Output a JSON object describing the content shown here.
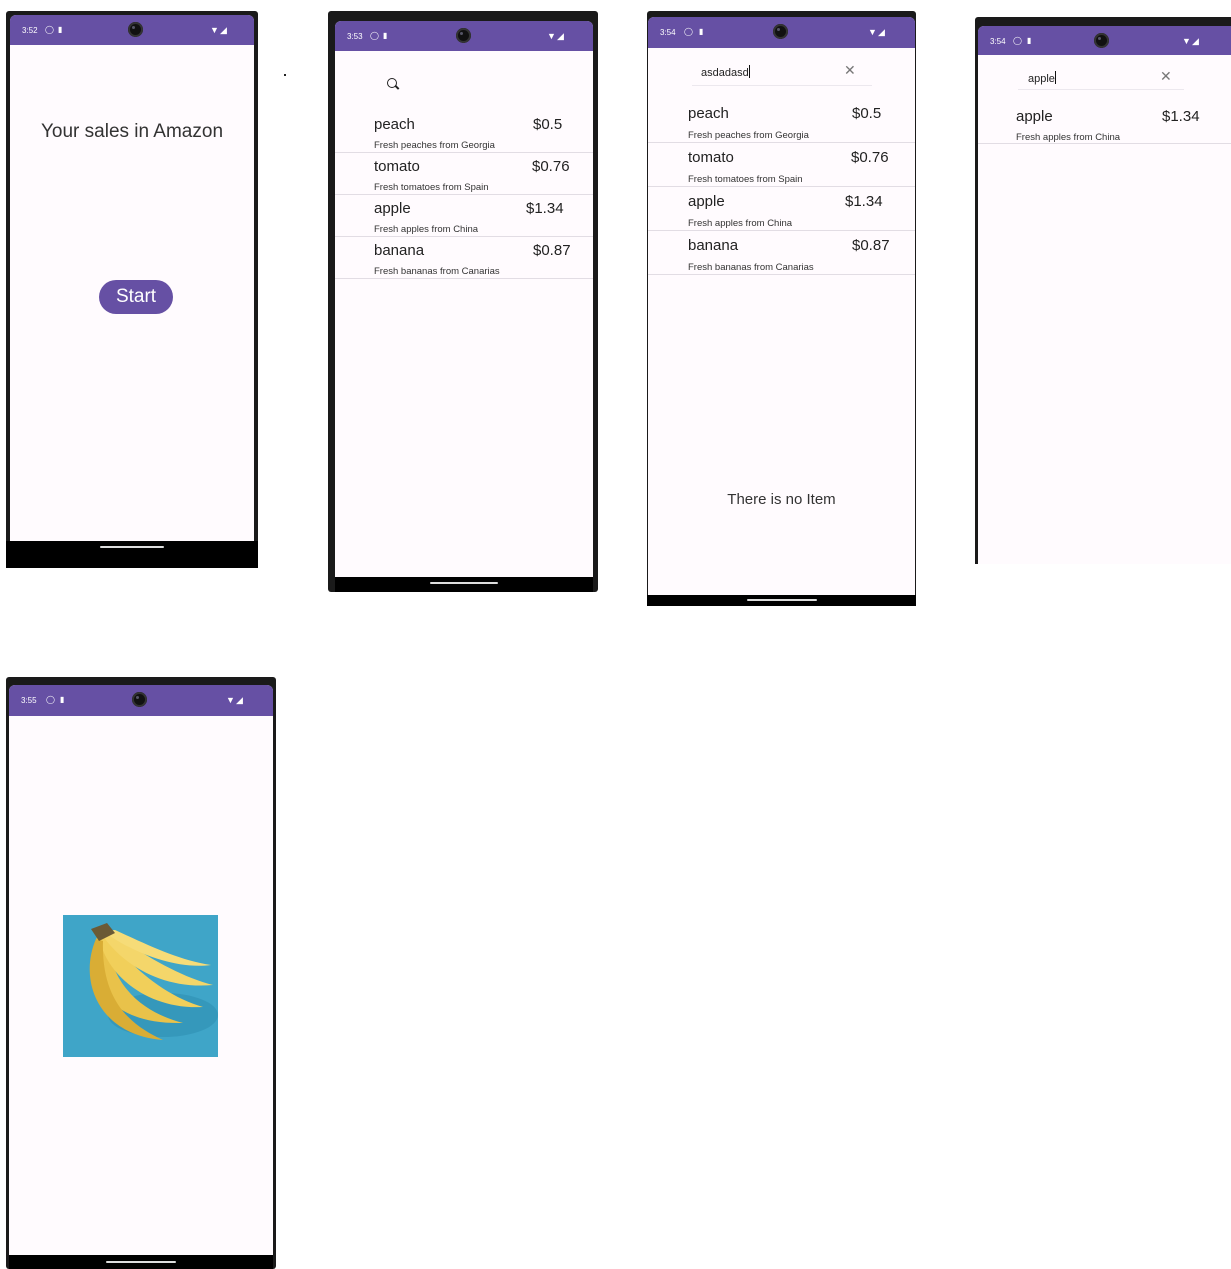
{
  "screen1": {
    "time": "3:52",
    "title": "Your sales in Amazon",
    "start_label": "Start"
  },
  "screen2": {
    "time": "3:53",
    "search_icon": "search-icon",
    "products": [
      {
        "name": "peach",
        "price": "$0.5",
        "desc": "Fresh peaches from Georgia"
      },
      {
        "name": "tomato",
        "price": "$0.76",
        "desc": "Fresh tomatoes from Spain"
      },
      {
        "name": "apple",
        "price": "$1.34",
        "desc": "Fresh apples from China"
      },
      {
        "name": "banana",
        "price": "$0.87",
        "desc": "Fresh bananas from Canarias"
      }
    ]
  },
  "screen3": {
    "time": "3:54",
    "query": "asdadasd",
    "clear_icon": "close-icon",
    "products": [
      {
        "name": "peach",
        "price": "$0.5",
        "desc": "Fresh peaches from Georgia"
      },
      {
        "name": "tomato",
        "price": "$0.76",
        "desc": "Fresh tomatoes from Spain"
      },
      {
        "name": "apple",
        "price": "$1.34",
        "desc": "Fresh apples from China"
      },
      {
        "name": "banana",
        "price": "$0.87",
        "desc": "Fresh bananas from Canarias"
      }
    ],
    "empty_message": "There is no Item"
  },
  "screen4": {
    "time": "3:54",
    "query": "apple",
    "clear_icon": "close-icon",
    "products": [
      {
        "name": "apple",
        "price": "$1.34",
        "desc": "Fresh apples from China"
      }
    ]
  },
  "screen5": {
    "time": "3:55",
    "image": "banana-photo"
  },
  "colors": {
    "status_bar": "#6650a4",
    "button": "#6650a4",
    "screen_bg": "#fffbfe",
    "banana_bg": "#3fa5c8",
    "banana_yellow": "#f1cf5a"
  },
  "icons": {
    "status": [
      "alarm-icon",
      "sd-card-icon",
      "wifi-icon",
      "signal-icon"
    ]
  }
}
